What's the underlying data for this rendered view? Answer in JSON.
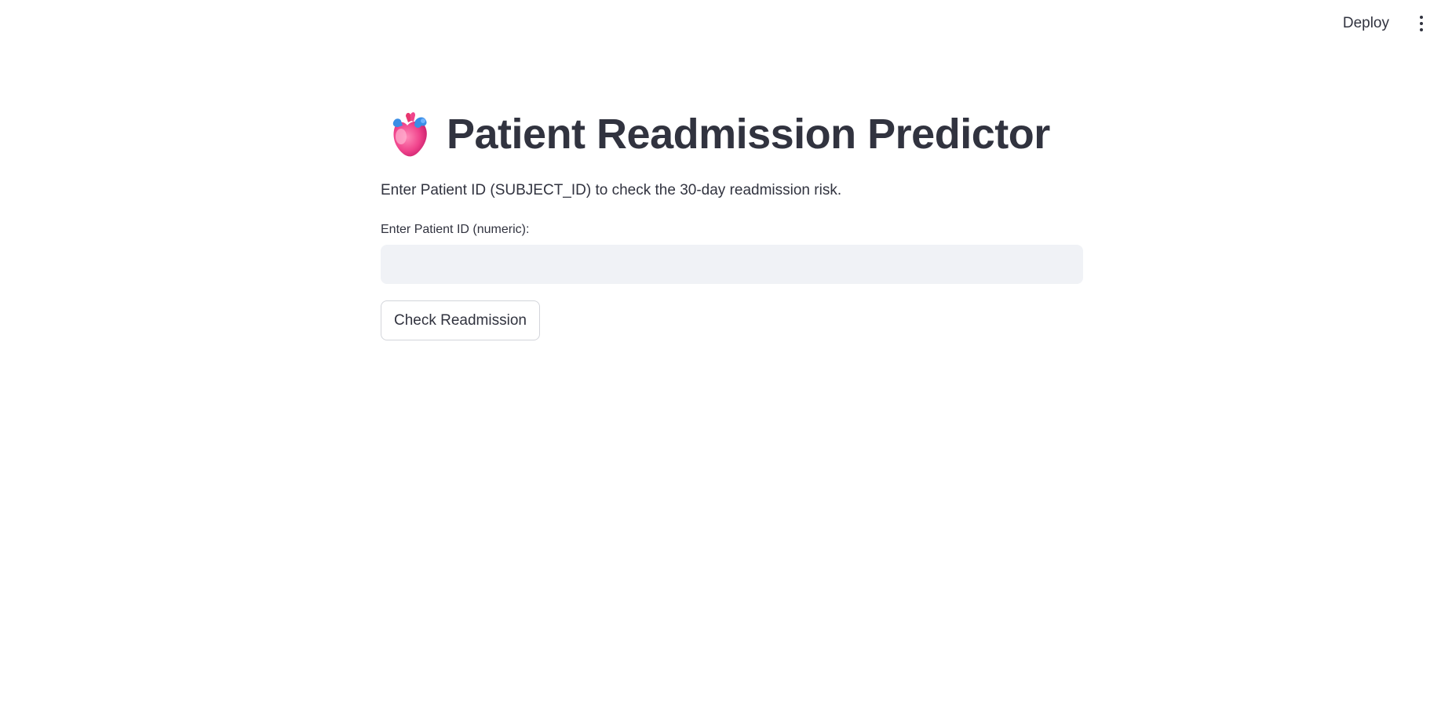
{
  "header": {
    "deploy_label": "Deploy",
    "menu_icon": "more-vertical-icon"
  },
  "main": {
    "title_icon": "anatomical-heart-icon",
    "title": "Patient Readmission Predictor",
    "description": "Enter Patient ID (SUBJECT_ID) to check the 30-day readmission risk.",
    "input": {
      "label": "Enter Patient ID (numeric):",
      "value": "",
      "placeholder": ""
    },
    "button_label": "Check Readmission"
  },
  "colors": {
    "text": "#31333f",
    "input_bg": "#f0f2f6",
    "button_border": "#d3d5db",
    "heart_pink": "#f0448c",
    "heart_blue": "#3a8ee6"
  }
}
